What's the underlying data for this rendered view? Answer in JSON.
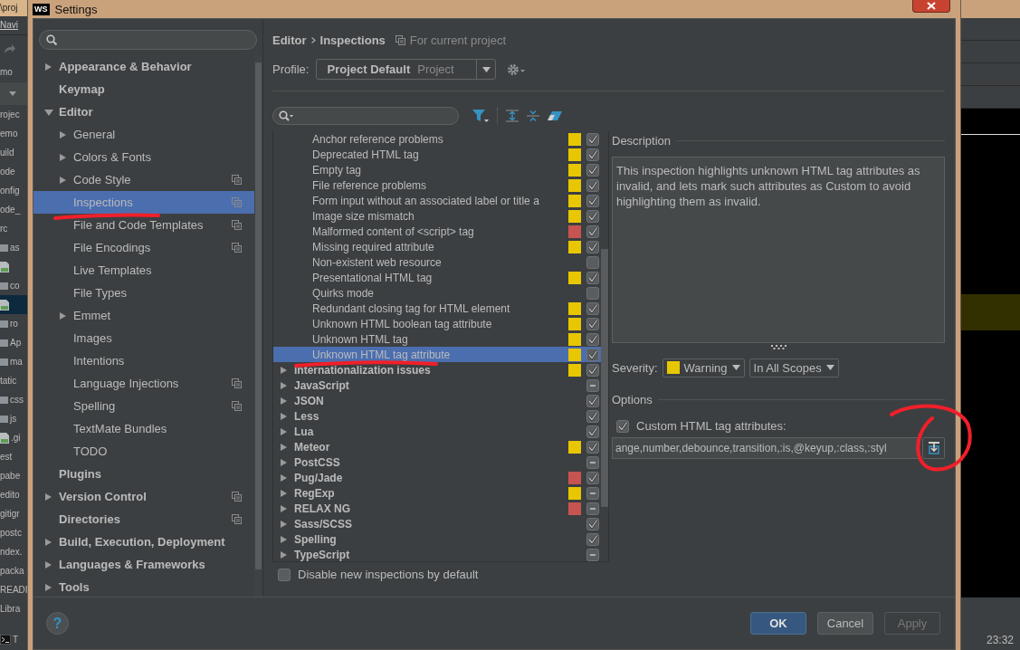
{
  "desktop_left": {
    "title_fragment": "\\proj",
    "menu_fragment": "Navi",
    "breadcrumb_fragment": "mo",
    "tree": [
      {
        "kind": "plain",
        "text": "rojec",
        "selected": false
      },
      {
        "kind": "plain",
        "text": "emo",
        "selected": false
      },
      {
        "kind": "plain",
        "text": "uild",
        "selected": false
      },
      {
        "kind": "plain",
        "text": "ode",
        "selected": false
      },
      {
        "kind": "plain",
        "text": "onfig",
        "selected": false
      },
      {
        "kind": "plain",
        "text": "ode_",
        "selected": false
      },
      {
        "kind": "plain",
        "text": "rc",
        "selected": false
      },
      {
        "kind": "folder",
        "text": "as",
        "selected": false
      },
      {
        "kind": "file",
        "selected": false
      },
      {
        "kind": "folder",
        "text": "co",
        "selected": false
      },
      {
        "kind": "file",
        "selected": true
      },
      {
        "kind": "folder",
        "text": "ro",
        "selected": false
      },
      {
        "kind": "folder",
        "text": "Ap",
        "selected": false
      },
      {
        "kind": "folder",
        "text": "ma",
        "selected": false
      },
      {
        "kind": "plain",
        "text": "tatic",
        "selected": false
      },
      {
        "kind": "folder",
        "text": "css",
        "selected": false
      },
      {
        "kind": "folder",
        "text": "js",
        "selected": false
      },
      {
        "kind": "file",
        "text": ".gi",
        "selected": false
      },
      {
        "kind": "plain",
        "text": "est",
        "selected": false
      },
      {
        "kind": "plain",
        "text": "pabe",
        "selected": false
      },
      {
        "kind": "plain",
        "text": "edito",
        "selected": false
      },
      {
        "kind": "plain",
        "text": "gitigr",
        "selected": false
      },
      {
        "kind": "plain",
        "text": "postc",
        "selected": false
      },
      {
        "kind": "plain",
        "text": "ndex.",
        "selected": false
      },
      {
        "kind": "plain",
        "text": "packa",
        "selected": false
      },
      {
        "kind": "plain",
        "text": "READI",
        "selected": false
      },
      {
        "kind": "plain",
        "text": "Libra",
        "selected": false
      }
    ],
    "terminal_fragment": "T"
  },
  "desktop_right": {
    "clock": "23:32"
  },
  "window": {
    "logo": "WS",
    "title": "Settings"
  },
  "sidebar": {
    "items": [
      {
        "name": "Appearance & Behavior",
        "expanded": false,
        "project": false,
        "selected": false
      },
      {
        "name": "Keymap",
        "project": false,
        "selected": false
      },
      {
        "name": "Editor",
        "expanded": true,
        "project": false,
        "selected": false,
        "children": [
          {
            "name": "General",
            "expanded": false,
            "project": false,
            "selected": false
          },
          {
            "name": "Colors & Fonts",
            "expanded": false,
            "project": false,
            "selected": false
          },
          {
            "name": "Code Style",
            "expanded": false,
            "project": true,
            "selected": false
          },
          {
            "name": "Inspections",
            "project": true,
            "selected": true
          },
          {
            "name": "File and Code Templates",
            "project": true,
            "selected": false
          },
          {
            "name": "File Encodings",
            "project": true,
            "selected": false
          },
          {
            "name": "Live Templates",
            "project": false,
            "selected": false
          },
          {
            "name": "File Types",
            "project": false,
            "selected": false
          },
          {
            "name": "Emmet",
            "expanded": false,
            "project": false,
            "selected": false
          },
          {
            "name": "Images",
            "project": false,
            "selected": false
          },
          {
            "name": "Intentions",
            "project": false,
            "selected": false
          },
          {
            "name": "Language Injections",
            "project": true,
            "selected": false
          },
          {
            "name": "Spelling",
            "project": true,
            "selected": false
          },
          {
            "name": "TextMate Bundles",
            "project": false,
            "selected": false
          },
          {
            "name": "TODO",
            "project": false,
            "selected": false
          }
        ]
      },
      {
        "name": "Plugins",
        "project": false,
        "selected": false
      },
      {
        "name": "Version Control",
        "expanded": false,
        "project": true,
        "selected": false
      },
      {
        "name": "Directories",
        "project": true,
        "selected": false
      },
      {
        "name": "Build, Execution, Deployment",
        "expanded": false,
        "project": false,
        "selected": false
      },
      {
        "name": "Languages & Frameworks",
        "expanded": false,
        "project": false,
        "selected": false
      },
      {
        "name": "Tools",
        "expanded": false,
        "project": false,
        "selected": false
      }
    ]
  },
  "header": {
    "breadcrumb": [
      "Editor",
      "Inspections"
    ],
    "scope_note": "For current project"
  },
  "profile": {
    "label": "Profile:",
    "value": "Project Default",
    "value_note": "Project"
  },
  "inspections": {
    "items": [
      {
        "children": [
          {
            "name": "Anchor reference problems",
            "color": "#e8c600",
            "checked": true,
            "mixed": false,
            "selected": false
          },
          {
            "name": "Deprecated HTML tag",
            "color": "#e8c600",
            "checked": true,
            "mixed": false,
            "selected": false
          },
          {
            "name": "Empty tag",
            "color": "#e8c600",
            "checked": true,
            "mixed": false,
            "selected": false
          },
          {
            "name": "File reference problems",
            "color": "#e8c600",
            "checked": true,
            "mixed": false,
            "selected": false
          },
          {
            "name": "Form input without an associated label or title a",
            "color": "#e8c600",
            "checked": true,
            "mixed": false,
            "selected": false
          },
          {
            "name": "Image size mismatch",
            "color": "#e8c600",
            "checked": true,
            "mixed": false,
            "selected": false
          },
          {
            "name": "Malformed content of <script> tag",
            "color": "#c75450",
            "checked": true,
            "mixed": false,
            "selected": false
          },
          {
            "name": "Missing required attribute",
            "color": "#e8c600",
            "checked": true,
            "mixed": false,
            "selected": false
          },
          {
            "name": "Non-existent web resource",
            "checked": false,
            "mixed": false,
            "selected": false
          },
          {
            "name": "Presentational HTML tag",
            "color": "#e8c600",
            "checked": true,
            "mixed": false,
            "selected": false
          },
          {
            "name": "Quirks mode",
            "checked": false,
            "mixed": false,
            "selected": false
          },
          {
            "name": "Redundant closing tag for HTML element",
            "color": "#e8c600",
            "checked": true,
            "mixed": false,
            "selected": false
          },
          {
            "name": "Unknown HTML boolean tag attribute",
            "color": "#e8c600",
            "checked": true,
            "mixed": false,
            "selected": false
          },
          {
            "name": "Unknown HTML tag",
            "color": "#e8c600",
            "checked": true,
            "mixed": false,
            "selected": false
          },
          {
            "name": "Unknown HTML tag attribute",
            "color": "#e8c600",
            "checked": true,
            "mixed": false,
            "selected": true
          }
        ]
      },
      {
        "name": "Internationalization issues",
        "expanded": false,
        "color": "#e8c600",
        "checked": true,
        "mixed": false,
        "selected": false
      },
      {
        "name": "JavaScript",
        "expanded": false,
        "mixed": true,
        "selected": false
      },
      {
        "name": "JSON",
        "expanded": false,
        "checked": true,
        "mixed": false,
        "selected": false
      },
      {
        "name": "Less",
        "expanded": false,
        "checked": true,
        "mixed": false,
        "selected": false
      },
      {
        "name": "Lua",
        "expanded": false,
        "checked": true,
        "mixed": false,
        "selected": false
      },
      {
        "name": "Meteor",
        "expanded": false,
        "color": "#e8c600",
        "checked": true,
        "mixed": false,
        "selected": false
      },
      {
        "name": "PostCSS",
        "expanded": false,
        "mixed": true,
        "selected": false
      },
      {
        "name": "Pug/Jade",
        "expanded": false,
        "color": "#c75450",
        "checked": true,
        "mixed": false,
        "selected": false
      },
      {
        "name": "RegExp",
        "expanded": false,
        "color": "#e8c600",
        "mixed": true,
        "selected": false
      },
      {
        "name": "RELAX NG",
        "expanded": false,
        "color": "#c75450",
        "mixed": true,
        "selected": false
      },
      {
        "name": "Sass/SCSS",
        "expanded": false,
        "checked": true,
        "mixed": false,
        "selected": false
      },
      {
        "name": "Spelling",
        "expanded": false,
        "checked": true,
        "mixed": false,
        "selected": false
      },
      {
        "name": "TypeScript",
        "expanded": false,
        "mixed": true,
        "selected": false
      }
    ]
  },
  "disable_new": {
    "label": "Disable new inspections by default",
    "checked": false
  },
  "description": {
    "title": "Description",
    "text": "This inspection highlights unknown HTML tag attributes as invalid, and lets mark such attributes as Custom to avoid highlighting them as invalid."
  },
  "severity": {
    "label": "Severity:",
    "value": "Warning",
    "color": "#e8c600",
    "scope": "In All Scopes"
  },
  "options": {
    "title": "Options",
    "custom_attributes": {
      "label": "Custom HTML tag attributes:",
      "checked": true,
      "value": "ange,number,debounce,transition,:is,@keyup,:class,:styl"
    }
  },
  "help": "?",
  "buttons": [
    {
      "label": "OK",
      "kind": "default",
      "disabled": false
    },
    {
      "label": "Cancel",
      "kind": "normal",
      "disabled": false
    },
    {
      "label": "Apply",
      "kind": "normal",
      "disabled": true
    }
  ]
}
